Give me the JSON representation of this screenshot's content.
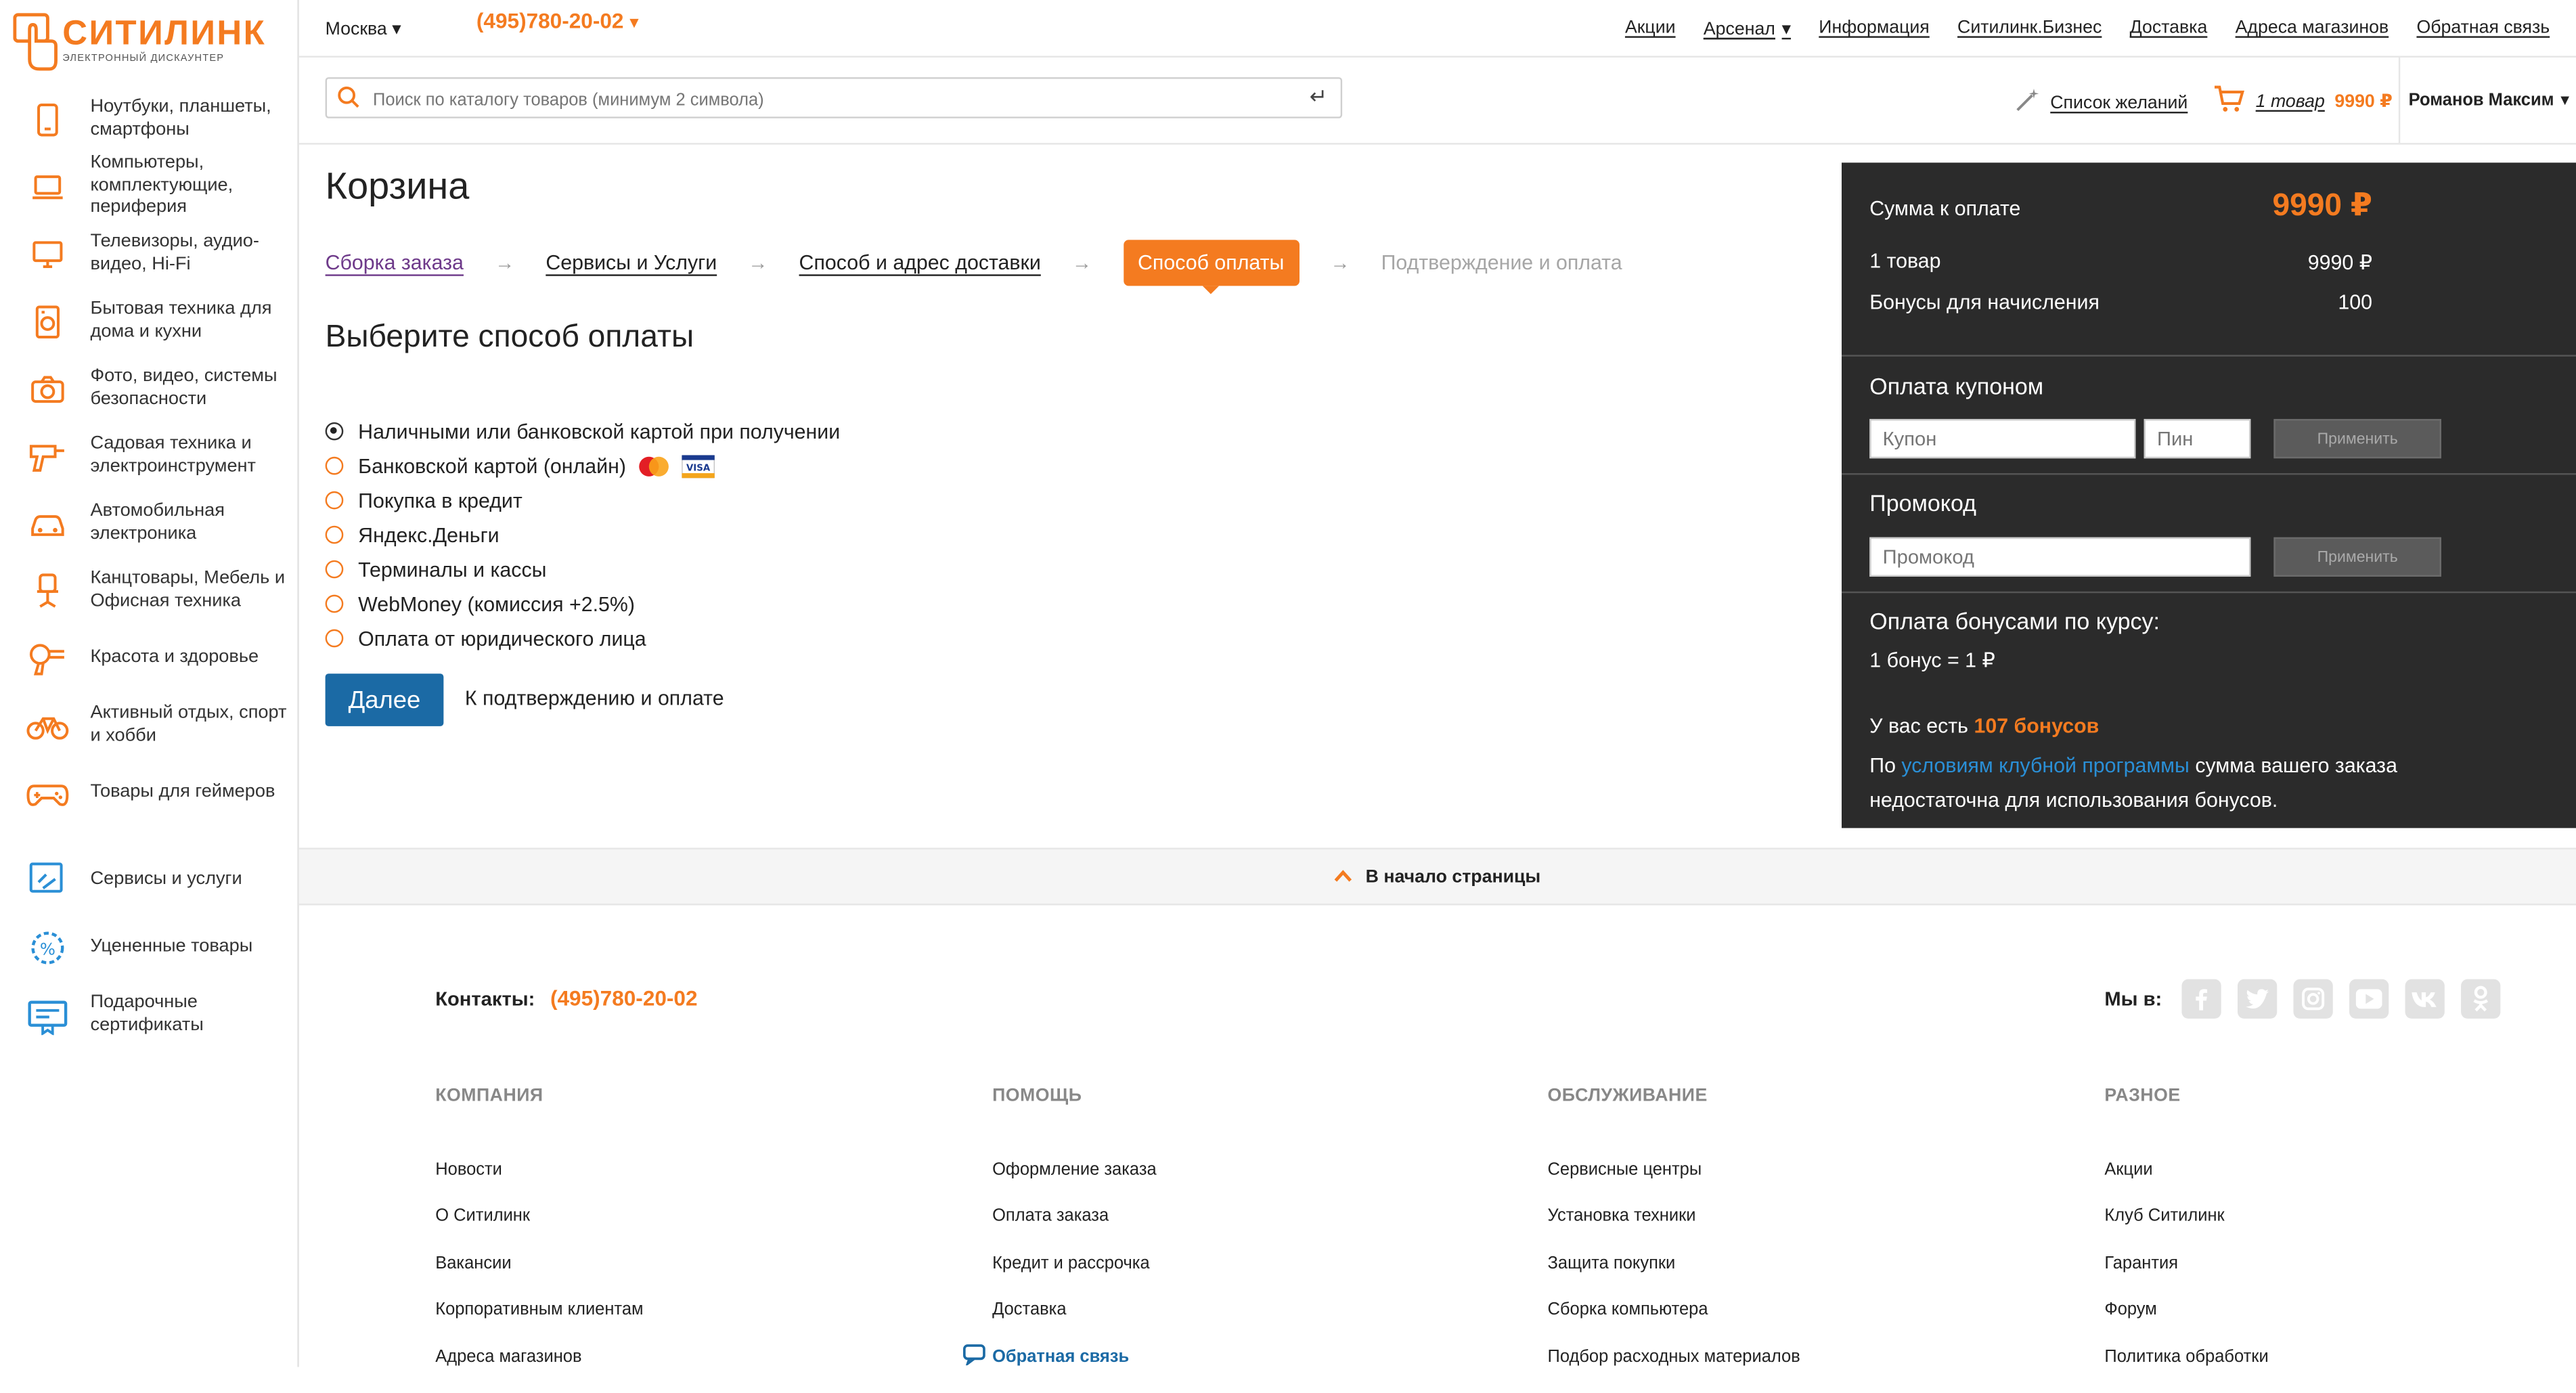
{
  "brand": {
    "name": "СИТИЛИНК",
    "tagline": "ЭЛЕКТРОННЫЙ ДИСКАУНТЕР"
  },
  "sidebar": {
    "items": [
      {
        "label": "Ноутбуки, планшеты, смартфоны",
        "icon": "smartphone-icon"
      },
      {
        "label": "Компьютеры, комплектующие, периферия",
        "icon": "laptop-icon"
      },
      {
        "label": "Телевизоры, аудио-видео, Hi-Fi",
        "icon": "tv-icon"
      },
      {
        "label": "Бытовая техника для дома и кухни",
        "icon": "appliance-icon"
      },
      {
        "label": "Фото, видео, системы безопасности",
        "icon": "camera-icon"
      },
      {
        "label": "Садовая техника и электроинструмент",
        "icon": "drill-icon"
      },
      {
        "label": "Автомобильная электроника",
        "icon": "car-icon"
      },
      {
        "label": "Канцтовары, Мебель и Офисная техника",
        "icon": "office-chair-icon"
      },
      {
        "label": "Красота и здоровье",
        "icon": "hairdryer-icon"
      },
      {
        "label": "Активный отдых, спорт и хобби",
        "icon": "bicycle-icon"
      },
      {
        "label": "Товары для геймеров",
        "icon": "gamepad-icon"
      }
    ],
    "extra": [
      {
        "label": "Сервисы и услуги",
        "icon": "services-icon"
      },
      {
        "label": "Уцененные товары",
        "icon": "discount-icon"
      },
      {
        "label": "Подарочные сертификаты",
        "icon": "gift-certificate-icon"
      }
    ]
  },
  "topbar": {
    "city": "Москва",
    "phone": "(495)780-20-02",
    "links": [
      "Акции",
      "Арсенал",
      "Информация",
      "Ситилинк.Бизнес",
      "Доставка",
      "Адреса магазинов",
      "Обратная связь"
    ]
  },
  "search": {
    "placeholder": "Поиск по каталогу товаров (минимум 2 символа)"
  },
  "header": {
    "wishlist": "Список желаний",
    "cart_count": "1 товар",
    "cart_price": "9990 ₽",
    "user": "Романов Максим"
  },
  "page": {
    "title": "Корзина",
    "steps": [
      "Сборка заказа",
      "Сервисы и Услуги",
      "Способ и адрес доставки",
      "Способ оплаты",
      "Подтверждение и оплата"
    ],
    "active_step": 3,
    "subtitle": "Выберите способ оплаты",
    "methods": [
      "Наличными или банковской картой при получении",
      "Банковской картой (онлайн)",
      "Покупка в кредит",
      "Яндекс.Деньги",
      "Терминалы и кассы",
      "WebMoney (комиссия +2.5%)",
      "Оплата от юридического лица"
    ],
    "selected_method": 0,
    "card_logos": [
      "MasterCard",
      "VISA"
    ],
    "next_button": "Далее",
    "next_hint": "К подтверждению и оплате"
  },
  "summary": {
    "total_label": "Сумма к оплате",
    "total_value": "9990 ₽",
    "items_label": "1 товар",
    "items_value": "9990 ₽",
    "bonus_label": "Бонусы для начисления",
    "bonus_value": "100",
    "coupon_title": "Оплата купоном",
    "coupon_placeholder": "Купон",
    "pin_placeholder": "Пин",
    "apply": "Применить",
    "promo_title": "Промокод",
    "promo_placeholder": "Промокод",
    "bonus_pay_title": "Оплата бонусами по курсу:",
    "bonus_rate": "1 бонус = 1 ₽",
    "you_have": "У вас есть",
    "bonus_count": "107 бонусов",
    "by": "По",
    "club_link": "условиям клубной программы",
    "club_rest_1": "сумма вашего заказа",
    "club_rest_2": "недостаточна для использования бонусов."
  },
  "to_top": "В начало страницы",
  "footer": {
    "contacts_label": "Контакты:",
    "contacts_phone": "(495)780-20-02",
    "social_label": "Мы в:",
    "columns": [
      {
        "title": "КОМПАНИЯ",
        "links": [
          "Новости",
          "О Ситилинк",
          "Вакансии",
          "Корпоративным клиентам",
          "Адреса магазинов"
        ]
      },
      {
        "title": "ПОМОЩЬ",
        "links": [
          "Оформление заказа",
          "Оплата заказа",
          "Кредит и рассрочка",
          "Доставка"
        ]
      },
      {
        "title": "ОБСЛУЖИВАНИЕ",
        "links": [
          "Сервисные центры",
          "Установка техники",
          "Защита покупки",
          "Сборка компьютера",
          "Подбор расходных материалов"
        ]
      },
      {
        "title": "РАЗНОЕ",
        "links": [
          "Акции",
          "Клуб Ситилинк",
          "Гарантия",
          "Форум",
          "Политика обработки"
        ]
      }
    ],
    "feedback": "Обратная связь"
  },
  "colors": {
    "accent": "#f47b20",
    "button": "#1b6aa5",
    "panel": "#2b2b2b",
    "link": "#2a8fd6"
  }
}
